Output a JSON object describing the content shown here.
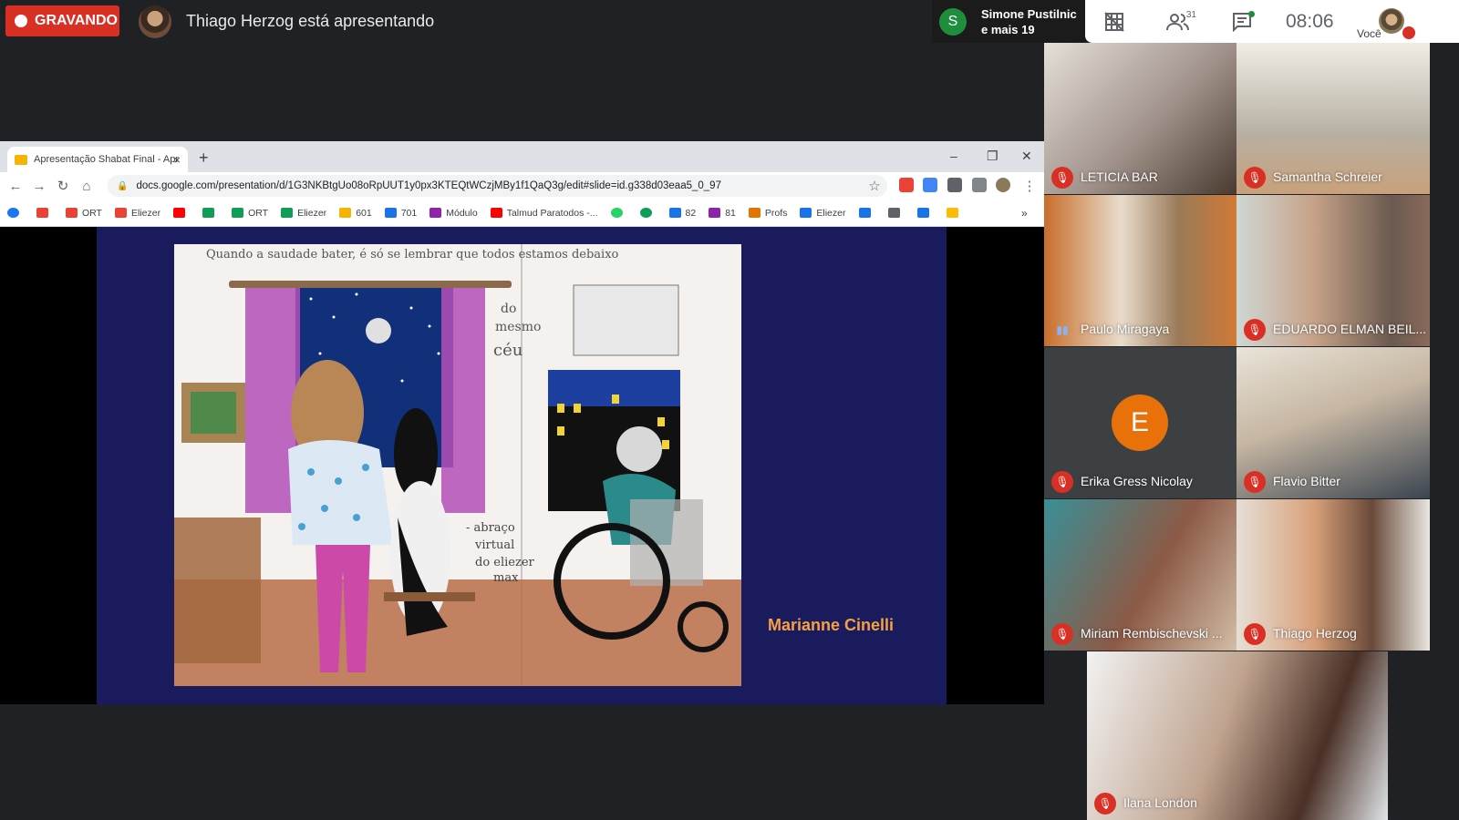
{
  "top_bar": {
    "recording_label": "GRAVANDO",
    "presenting_text": "Thiago Herzog está apresentando",
    "others": {
      "avatar_letter": "S",
      "line1": "Simone Pustilnic",
      "line2": "e mais 19"
    },
    "participants_count": "31",
    "time": "08:06",
    "you_label": "Você"
  },
  "browser": {
    "tab_title": "Apresentação Shabat Final - Apr",
    "url": "docs.google.com/presentation/d/1G3NKBtgUo08oRpUUT1y0px3KTEQtWCzjMBy1f1QaQ3g/edit#slide=id.g338d03eaa5_0_97",
    "bookmarks": [
      "ORT",
      "Eliezer",
      "ORT",
      "Eliezer",
      "601",
      "701",
      "Módulo",
      "Talmud Paratodos -...",
      "82",
      "81",
      "Profs",
      "Eliezer"
    ]
  },
  "slide": {
    "drawing_text_top": "Quando a saudade bater, é só se lembrar que todos estamos debaixo",
    "drawing_text_right": [
      "do",
      "mesmo",
      "céu"
    ],
    "drawing_text_note": [
      "- abraço",
      "virtual",
      "do eliezer",
      "max"
    ],
    "caption": "Marianne Cinelli"
  },
  "participants": [
    {
      "name": "LETICIA BAR",
      "muted": true
    },
    {
      "name": "Samantha Schreier",
      "muted": true
    },
    {
      "name": "Paulo Miragaya",
      "muted": false
    },
    {
      "name": "EDUARDO ELMAN BEIL...",
      "muted": true
    },
    {
      "name": "Erika Gress Nicolay",
      "muted": true,
      "avatar_letter": "E"
    },
    {
      "name": "Flavio Bitter",
      "muted": true
    },
    {
      "name": "Miriam Rembischevski ...",
      "muted": true
    },
    {
      "name": "Thiago Herzog",
      "muted": true
    },
    {
      "name": "Ilana London",
      "muted": true
    }
  ],
  "colors": {
    "record_red": "#d93025",
    "caption_orange": "#f5a142",
    "slide_navy": "#1a1b5c",
    "erika_avatar": "#e8710a"
  }
}
